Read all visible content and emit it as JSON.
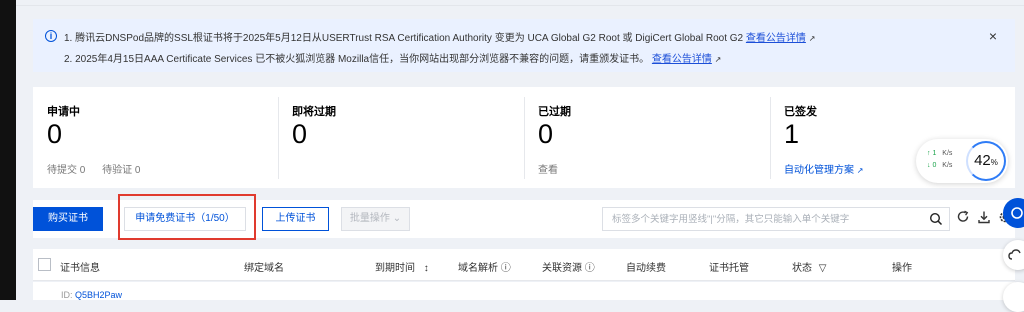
{
  "notice": {
    "line1_text": "1. 腾讯云DNSPod品牌的SSL根证书将于2025年5月12日从USERTrust RSA Certification Authority 变更为 UCA Global G2 Root 或 DigiCert Global Root G2",
    "line1_link": "查看公告详情",
    "line2_text": "2. 2025年4月15日AAA Certificate Services 已不被火狐浏览器 Mozilla信任，当你网站出现部分浏览器不兼容的问题，请重颁发证书。",
    "line2_link": "查看公告详情",
    "close": "×",
    "info_glyph": "i",
    "ext_glyph": "↗"
  },
  "stats": [
    {
      "title": "申请中",
      "value": "0",
      "sub1": "待提交 0",
      "sub2": "待验证 0"
    },
    {
      "title": "即将过期",
      "value": "0"
    },
    {
      "title": "已过期",
      "value": "0",
      "sub1": "查看"
    },
    {
      "title": "已签发",
      "value": "1",
      "link": "自动化管理方案"
    }
  ],
  "net": {
    "up": "↑ 1",
    "down": "↓ 0",
    "unit": "K/s",
    "cpu": "42",
    "cpu_unit": "%"
  },
  "toolbar": {
    "buy": "购买证书",
    "free": "申请免费证书（1/50）",
    "upload": "上传证书",
    "batch": "批量操作",
    "batch_caret": "⌄",
    "search_placeholder": "标签多个关键字用竖线\"|\"分隔，其它只能输入单个关键字"
  },
  "table": {
    "headers": [
      "证书信息",
      "绑定域名",
      "到期时间",
      "域名解析",
      "关联资源",
      "自动续费",
      "证书托管",
      "状态",
      "操作"
    ],
    "sort_glyph": "↕",
    "info_glyph": "ⓘ",
    "filter_glyph": "▽"
  },
  "row_partial": {
    "prefix": "ID:",
    "id": "Q5BH2Paw"
  },
  "colors": {
    "primary": "#0052d9",
    "highlight": "#e03a2e",
    "notice_bg": "#eaf1ff"
  }
}
